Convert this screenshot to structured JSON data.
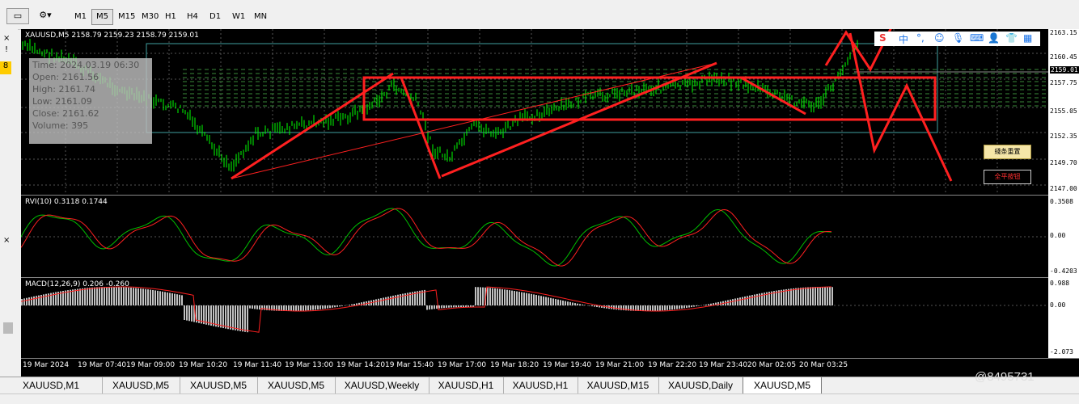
{
  "toolbar": {
    "timeframes": [
      "M1",
      "M5",
      "M15",
      "M30",
      "H1",
      "H4",
      "D1",
      "W1",
      "MN"
    ],
    "active_timeframe": "M5"
  },
  "chart": {
    "header": "XAUUSD,M5  2158.79 2159.23 2158.79 2159.01",
    "price_ticks": [
      "2163.15",
      "2160.45",
      "2159.01",
      "2157.75",
      "2155.05",
      "2152.35",
      "2149.70",
      "2147.00"
    ],
    "current_price": "2159.01",
    "info_box": {
      "time": "Time: 2024.03.19 06:30",
      "open": "Open: 2161.56",
      "high": "High: 2161.74",
      "low": "Low: 2161.09",
      "close": "Close: 2161.62",
      "volume": "Volume: 395"
    },
    "buttons": {
      "yellow": "綫条重置",
      "red": "全平按钮"
    },
    "ime_char": "中"
  },
  "rvi": {
    "header": "RVI(10) 0.3118 0.1744",
    "ticks": [
      "0.3508",
      "0.00",
      "-0.4203"
    ]
  },
  "macd": {
    "header": "MACD(12,26,9) 0.206 -0.260",
    "ticks": [
      "0.988",
      "0.00",
      "-2.073"
    ]
  },
  "time_axis": [
    "19 Mar 2024",
    "19 Mar 07:40",
    "19 Mar 09:00",
    "19 Mar 10:20",
    "19 Mar 11:40",
    "19 Mar 13:00",
    "19 Mar 14:20",
    "19 Mar 15:40",
    "19 Mar 17:00",
    "19 Mar 18:20",
    "19 Mar 19:40",
    "19 Mar 21:00",
    "19 Mar 22:20",
    "19 Mar 23:40",
    "20 Mar 02:05",
    "20 Mar 03:25"
  ],
  "tabs": [
    "XAUUSD,M1",
    "XAUUSD,M5",
    "XAUUSD,M5",
    "XAUUSD,M5",
    "XAUUSD,Weekly",
    "XAUUSD,H1",
    "XAUUSD,H1",
    "XAUUSD,M15",
    "XAUUSD,Daily",
    "XAUUSD,M5"
  ],
  "active_tab": 9,
  "watermark": "@8495731",
  "colors": {
    "candle": "#00ff00",
    "signal": "#ff0000",
    "drawing": "#ff2020",
    "background": "#000000",
    "hist": "#c0c0c0"
  }
}
